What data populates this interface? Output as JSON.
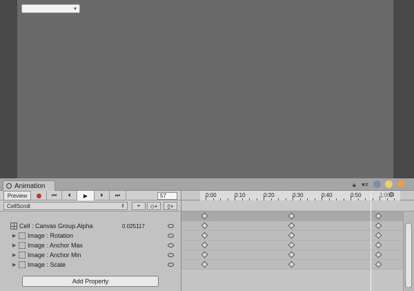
{
  "window": {
    "tab_label": "Animation"
  },
  "toolbar": {
    "preview_label": "Preview",
    "frame_value": "57"
  },
  "clip": {
    "selected": "CellScroll"
  },
  "timeline": {
    "tick_labels": [
      "0:00",
      "0:10",
      "0:20",
      "0:30",
      "0:40",
      "0:50",
      "1:00"
    ]
  },
  "properties": [
    {
      "label": "Cell : Canvas Group.Alpha",
      "value": "0.025117"
    },
    {
      "label": "Image : Rotation"
    },
    {
      "label": "Image : Anchor Max"
    },
    {
      "label": "Image : Anchor Min"
    },
    {
      "label": "Image : Scale"
    }
  ],
  "add_property_label": "Add Property",
  "colors": {
    "record": "#c0392b",
    "window_circle_blue": "#7d8fa8",
    "window_circle_yellow": "#e8d36a",
    "window_circle_orange": "#e79a5a"
  },
  "icons": [
    "clock-icon",
    "record-icon",
    "first-key-icon",
    "prev-key-icon",
    "play-icon",
    "next-key-icon",
    "last-key-icon",
    "add-keyframe-icon",
    "add-event-icon",
    "settings-gear-icon",
    "eye-icon"
  ]
}
